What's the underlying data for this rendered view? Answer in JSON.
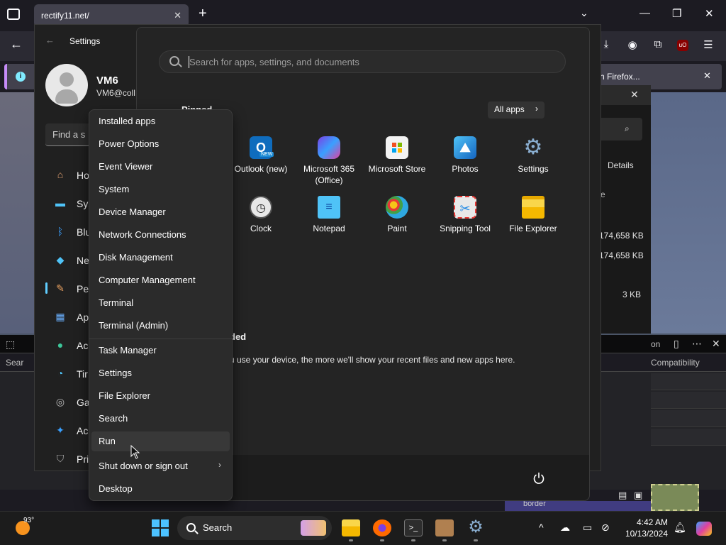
{
  "browser": {
    "tab_title": "rectify11.net/",
    "notification_text": "h Firefox..."
  },
  "settings_window": {
    "title": "Settings",
    "user_name": "VM6",
    "user_email": "VM6@coll",
    "find_placeholder": "Find a s",
    "nav": [
      {
        "label": "Ho",
        "icon": "home-icon"
      },
      {
        "label": "Sys",
        "icon": "system-icon"
      },
      {
        "label": "Blu",
        "icon": "bluetooth-icon"
      },
      {
        "label": "Ne",
        "icon": "network-icon"
      },
      {
        "label": "Pe",
        "icon": "personalization-icon"
      },
      {
        "label": "Ap",
        "icon": "apps-icon"
      },
      {
        "label": "Ac",
        "icon": "accounts-icon"
      },
      {
        "label": "Tir",
        "icon": "time-icon"
      },
      {
        "label": "Ga",
        "icon": "gaming-icon"
      },
      {
        "label": "Ac",
        "icon": "accessibility-icon"
      },
      {
        "label": "Pri",
        "icon": "privacy-icon"
      }
    ]
  },
  "background_explorer": {
    "tab_label": "Details",
    "col_header": "e",
    "sizes": [
      "174,658 KB",
      "174,658 KB",
      "3 KB"
    ]
  },
  "devtools": {
    "search_label": "Sear",
    "tab_label": "on",
    "compat_label": "Compatibility",
    "footer_label": "border"
  },
  "start_menu": {
    "search_placeholder": "Search for apps, settings, and documents",
    "pinned_label": "Pinned",
    "all_apps_label": "All apps",
    "apps": [
      {
        "label": "Outlook (new)",
        "icon": "outlook-icon",
        "badge": "NEW",
        "color": "#0f6cbd"
      },
      {
        "label": "Microsoft 365 (Office)",
        "icon": "m365-icon",
        "color": "#7b3fe4"
      },
      {
        "label": "Microsoft Store",
        "icon": "store-icon",
        "color": "#f3f3f3"
      },
      {
        "label": "Photos",
        "icon": "photos-icon",
        "color": "#1e88e5"
      },
      {
        "label": "Settings",
        "icon": "settings-icon",
        "color": "#5a7fa8"
      },
      {
        "label": "Clock",
        "icon": "clock-icon",
        "color": "#e0e0e0"
      },
      {
        "label": "Notepad",
        "icon": "notepad-icon",
        "color": "#4fc3f7"
      },
      {
        "label": "Paint",
        "icon": "paint-icon",
        "color": "#2ea8e0"
      },
      {
        "label": "Snipping Tool",
        "icon": "snipping-tool-icon",
        "color": "#e8e8e8"
      },
      {
        "label": "File Explorer",
        "icon": "file-explorer-icon",
        "color": "#f5c518"
      }
    ],
    "recommended_label": "ded",
    "recommended_text": "u use your device, the more we'll show your recent files and new apps here."
  },
  "context_menu": {
    "items": [
      {
        "label": "Installed apps"
      },
      {
        "label": "Power Options"
      },
      {
        "label": "Event Viewer"
      },
      {
        "label": "System"
      },
      {
        "label": "Device Manager"
      },
      {
        "label": "Network Connections"
      },
      {
        "label": "Disk Management"
      },
      {
        "label": "Computer Management"
      },
      {
        "label": "Terminal"
      },
      {
        "label": "Terminal (Admin)"
      },
      {
        "label": "Task Manager"
      },
      {
        "label": "Settings"
      },
      {
        "label": "File Explorer"
      },
      {
        "label": "Search"
      },
      {
        "label": "Run"
      },
      {
        "label": "Shut down or sign out"
      },
      {
        "label": "Desktop"
      }
    ]
  },
  "taskbar": {
    "weather_temp": "93°",
    "search_label": "Search",
    "time": "4:42 AM",
    "date": "10/13/2024",
    "accent": "#4cc2ff"
  }
}
